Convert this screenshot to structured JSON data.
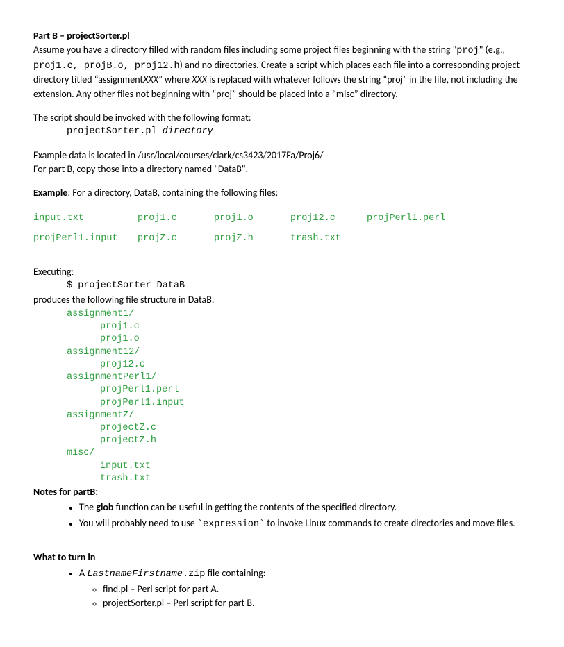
{
  "header": {
    "partLabel": "Part B – projectSorter.pl"
  },
  "intro": {
    "t1": "Assume you have a directory filled with random files including some project files beginning with the string \"",
    "projWord": "proj",
    "t2": "\" (e.g., ",
    "eg": "proj1.c, projB.o, proj12.h",
    "t3": ") and no directories. Create a script which places each file into a corresponding project directory titled “assignment",
    "xxx": "XXX",
    "t4": "” where ",
    "xxx2": "XXX",
    "t5": " is replaced with whatever follows the string “proj” in the file, not including the extension. Any other files not beginning with “proj” should be placed into a “misc” directory."
  },
  "invokeSentence": "The script should be invoked with the following format:",
  "invokeCmd": {
    "a": "projectSorter.pl ",
    "b": "directory"
  },
  "exampleData": {
    "l1": "Example data is located in /usr/local/courses/clark/cs3423/2017Fa/Proj6/",
    "l2": "For part B, copy those into a directory named \"DataB\"."
  },
  "exampleLine": {
    "bold": "Example",
    "rest": ": For a directory, DataB, containing the following files:"
  },
  "files": [
    "input.txt",
    "proj1.c",
    "proj1.o",
    "proj12.c",
    "projPerl1.perl",
    "projPerl1.input",
    "projZ.c",
    "projZ.h",
    "trash.txt",
    ""
  ],
  "exec": {
    "label": "Executing:",
    "cmd": "$ projectSorter DataB",
    "produces": "produces the following file structure in DataB:"
  },
  "tree": [
    {
      "ind": 1,
      "text": "assignment1/"
    },
    {
      "ind": 2,
      "text": "proj1.c"
    },
    {
      "ind": 2,
      "text": "proj1.o"
    },
    {
      "ind": 1,
      "text": "assignment12/"
    },
    {
      "ind": 2,
      "text": "proj12.c"
    },
    {
      "ind": 1,
      "text": "assignmentPerl1/"
    },
    {
      "ind": 2,
      "text": "projPerl1.perl"
    },
    {
      "ind": 2,
      "text": "projPerl1.input"
    },
    {
      "ind": 1,
      "text": "assignmentZ/"
    },
    {
      "ind": 2,
      "text": "projectZ.c"
    },
    {
      "ind": 2,
      "text": "projectZ.h"
    },
    {
      "ind": 1,
      "text": "misc/"
    },
    {
      "ind": 2,
      "text": "input.txt"
    },
    {
      "ind": 2,
      "text": "trash.txt"
    }
  ],
  "notesHeader": "Notes for partB:",
  "notes": {
    "n1a": "The ",
    "n1b": "glob",
    "n1c": " function can be useful in getting the contents of the specified directory.",
    "n2a": "You will probably need to use ",
    "n2b": "`expression`",
    "n2c": "  to invoke Linux commands to create directories and move files."
  },
  "turninHeader": "What to turn in",
  "turnin": {
    "zipA": "A ",
    "zipB": "LastnameFirstname",
    "zipC": ".zip",
    "zipD": " file containing:",
    "sub1": "find.pl – Perl script for part A.",
    "sub2": "projectSorter.pl – Perl script for part B."
  }
}
